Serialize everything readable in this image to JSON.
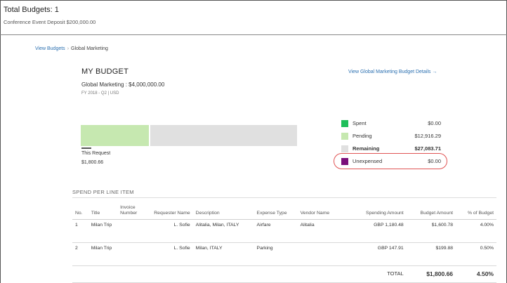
{
  "summary": {
    "total_budgets": "Total Budgets: 1",
    "conference_deposit": "Conference Event Deposit $200,000.00"
  },
  "breadcrumb": {
    "link": "View Budgets",
    "separator": "›",
    "current": "Global Marketing"
  },
  "budget": {
    "title": "MY BUDGET",
    "subtitle": "Global Marketing : $4,000,000.00",
    "fiscal": "FY 2018 - Q2 | USD",
    "details_link": "View Global Marketing Budget Details →"
  },
  "bar": {
    "pending_fraction": 0.32,
    "request_label": "This Request",
    "request_amount": "$1,800.66"
  },
  "legend": [
    {
      "label": "Spent",
      "value": "$0.00",
      "color": "#1fbf5a",
      "bold": false
    },
    {
      "label": "Pending",
      "value": "$12,916.29",
      "color": "#c6e8b0",
      "bold": false
    },
    {
      "label": "Remaining",
      "value": "$27,083.71",
      "color": "#e0e0e0",
      "bold": true
    },
    {
      "label": "Unexpensed",
      "value": "$0.00",
      "color": "#7b0f7b",
      "bold": false
    }
  ],
  "spend": {
    "title": "SPEND PER LINE ITEM",
    "headers": [
      "No.",
      "Title",
      "Invoice Number",
      "Requester Name",
      "Description",
      "Expense Type",
      "Vendor Name",
      "Spending Amount",
      "Budget Amount",
      "% of Budget"
    ],
    "rows": [
      [
        "1",
        "Milan Trip",
        "",
        "L. Sofie",
        "Alitalia, Milan, ITALY",
        "Airfare",
        "Alitalia",
        "GBP 1,180.48",
        "$1,600.78",
        "4.00%"
      ],
      [
        "2",
        "Milan Trip",
        "",
        "L. Sofie",
        "Milan, ITALY",
        "Parking",
        "",
        "GBP 147.91",
        "$199.88",
        "0.50%"
      ]
    ],
    "total_label": "TOTAL",
    "total_amount": "$1,800.66",
    "total_percent": "4.50%"
  }
}
